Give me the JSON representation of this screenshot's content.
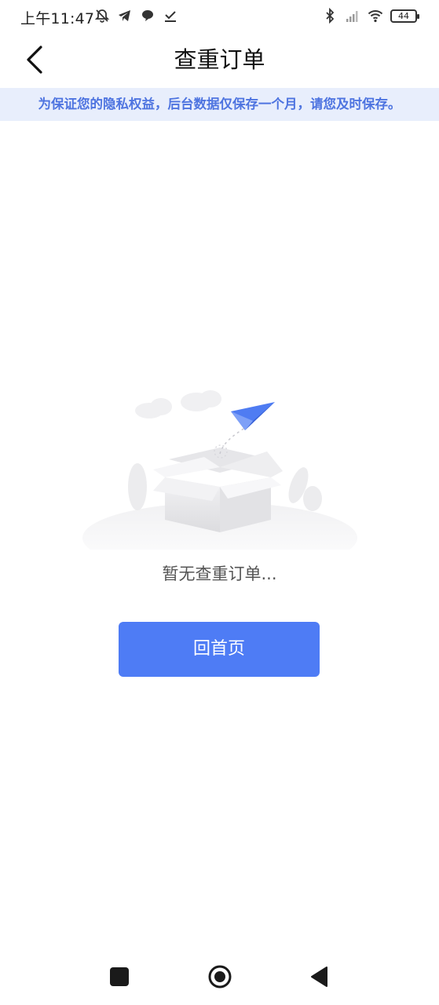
{
  "status_bar": {
    "time": "上午11:47",
    "left_icons": [
      "alarm-off-icon",
      "telegram-icon",
      "chat-bubble-icon",
      "download-done-icon"
    ],
    "right_icons": [
      "bluetooth-icon",
      "signal-icon",
      "wifi-icon"
    ],
    "battery_level": "44"
  },
  "header": {
    "title": "查重订单",
    "back_icon": "chevron-left-icon"
  },
  "notice": {
    "text": "为保证您的隐私权益，后台数据仅保存一个月，请您及时保存。"
  },
  "empty_state": {
    "illustration": "empty-box-paper-plane",
    "message": "暂无查重订单...",
    "button_label": "回首页"
  },
  "nav_bar": {
    "icons": [
      "recent-apps-icon",
      "home-icon",
      "back-icon"
    ]
  },
  "colors": {
    "accent": "#4e7cf5",
    "notice_bg": "#e8eefc",
    "notice_text": "#4e74e0",
    "text_secondary": "#555555"
  }
}
